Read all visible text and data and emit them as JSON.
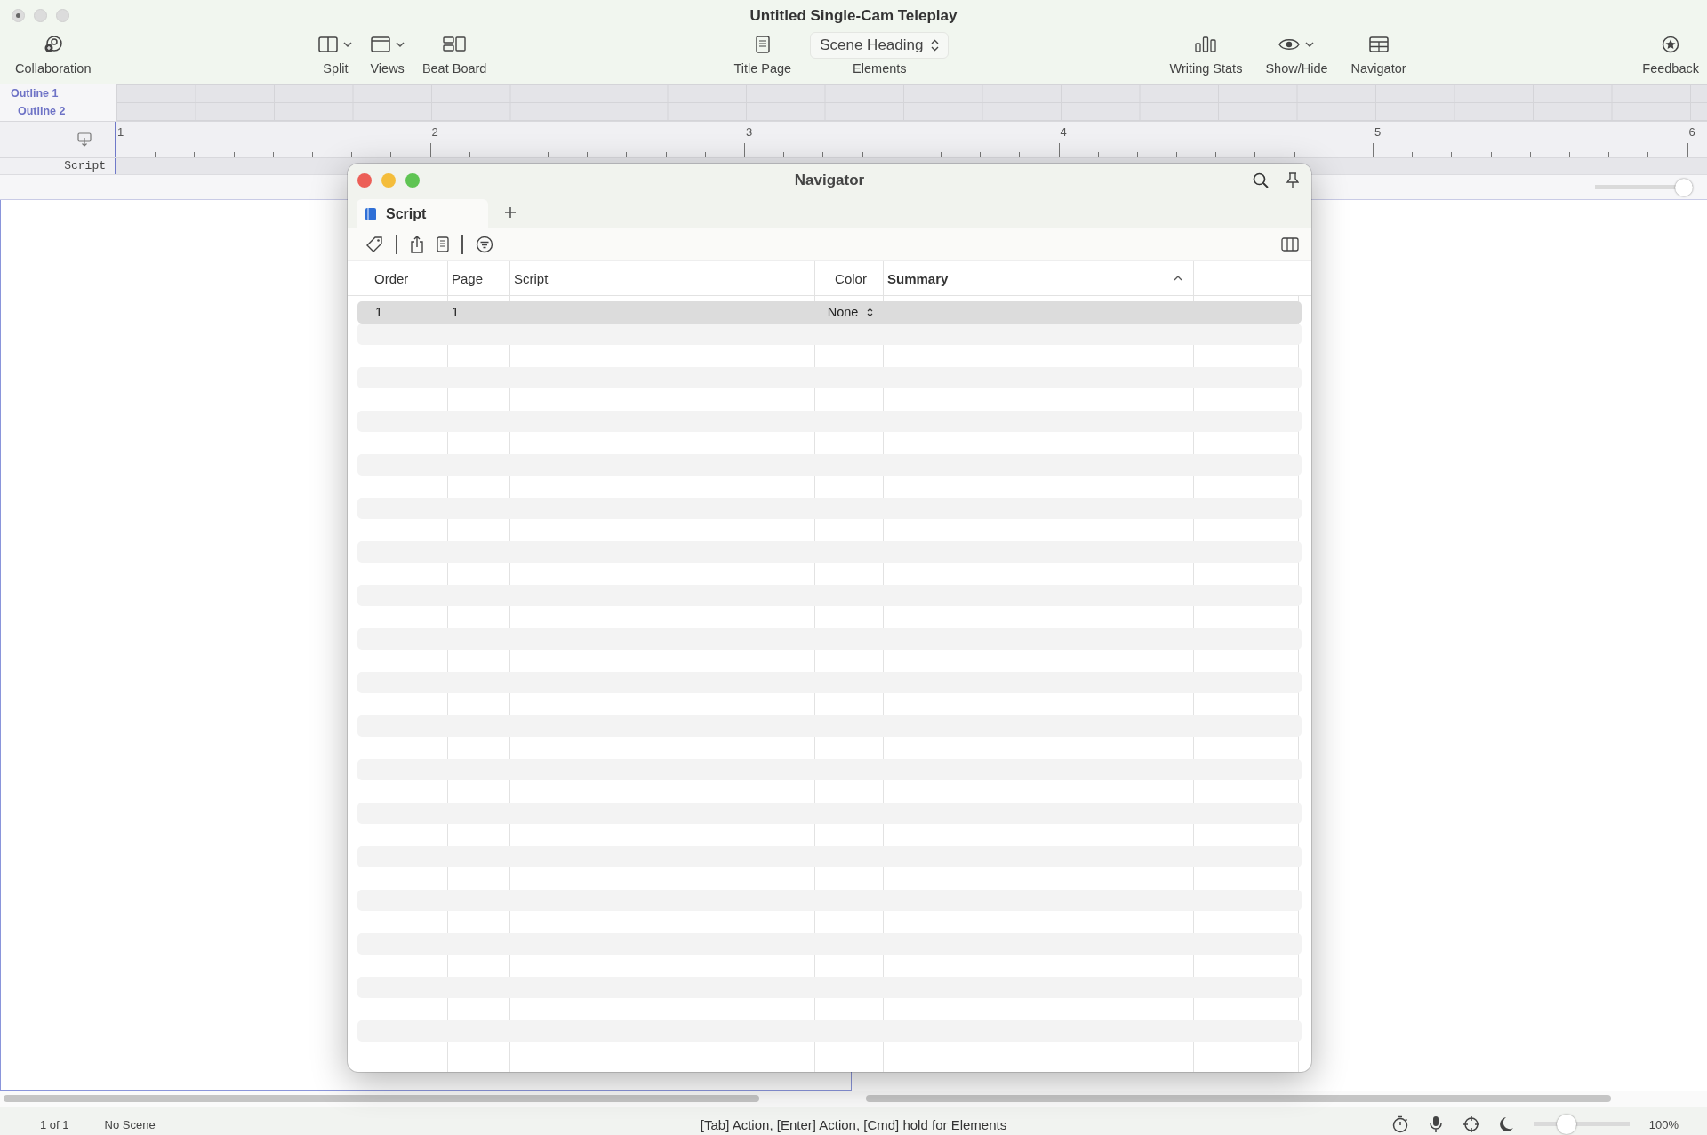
{
  "window": {
    "title": "Untitled Single-Cam Teleplay"
  },
  "toolbar": {
    "left": [
      {
        "label": "Collaboration",
        "menu": false
      }
    ],
    "middle": [
      {
        "label": "Split",
        "menu": true
      },
      {
        "label": "Views",
        "menu": true
      },
      {
        "label": "Beat Board",
        "menu": false
      }
    ],
    "center": [
      {
        "label": "Title Page",
        "kind": "button"
      },
      {
        "label": "Elements",
        "kind": "select",
        "value": "Scene Heading"
      }
    ],
    "right": [
      {
        "label": "Writing Stats",
        "menu": false
      },
      {
        "label": "Show/Hide",
        "menu": true
      },
      {
        "label": "Navigator",
        "menu": false
      }
    ],
    "far_right": [
      {
        "label": "Feedback",
        "menu": false
      }
    ]
  },
  "outline_rows": [
    "Outline 1",
    "Outline 2"
  ],
  "ruler": [
    "1",
    "2",
    "3",
    "4",
    "5",
    "6"
  ],
  "script_label": "Script",
  "page_width_slider": {
    "level": 1
  },
  "navigator": {
    "title": "Navigator",
    "tabs": [
      {
        "label": "Script",
        "selected": true
      }
    ],
    "columns": [
      {
        "label": "Order",
        "sorted": false
      },
      {
        "label": "Page",
        "sorted": false
      },
      {
        "label": "Script",
        "sorted": false
      },
      {
        "label": "Color",
        "sorted": false
      },
      {
        "label": "Summary",
        "sorted": true
      }
    ],
    "rows": [
      {
        "order": "1",
        "page": "1",
        "color_label": "None",
        "selected": true
      }
    ]
  },
  "status_bar": {
    "page": "1 of 1",
    "scene": "No Scene",
    "hint": "[Tab] Action, [Enter] Action, [Cmd] hold for Elements",
    "zoom": {
      "level": 0.3
    },
    "zoom_label": "100%"
  }
}
